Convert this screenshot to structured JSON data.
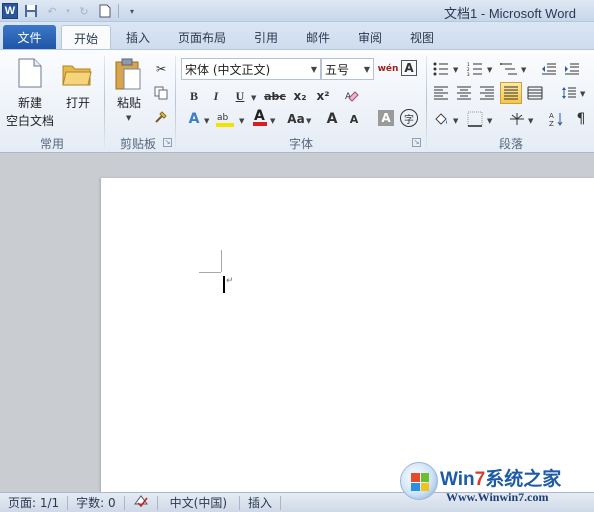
{
  "window": {
    "title": "文档1 - Microsoft Word",
    "app_icon_letter": "W"
  },
  "tabs": [
    {
      "label": "文件"
    },
    {
      "label": "开始"
    },
    {
      "label": "插入"
    },
    {
      "label": "页面布局"
    },
    {
      "label": "引用"
    },
    {
      "label": "邮件"
    },
    {
      "label": "审阅"
    },
    {
      "label": "视图"
    }
  ],
  "ribbon": {
    "groups": {
      "common": "常用",
      "clipboard": "剪贴板",
      "font": "字体",
      "paragraph": "段落"
    },
    "common": {
      "new_line1": "新建",
      "new_line2": "空白文档",
      "open": "打开"
    },
    "clipboard": {
      "paste": "粘贴"
    },
    "font": {
      "font_name": "宋体 (中文正文)",
      "font_size": "五号",
      "bold": "B",
      "italic": "I",
      "underline": "U",
      "strike": "abc",
      "subscript": "x₂",
      "superscript": "x²",
      "grow": "A",
      "shrink": "A",
      "change_case": "Aa",
      "char_shading": "A",
      "enclose": "字",
      "phonetic": "wén"
    }
  },
  "statusbar": {
    "page": "页面: 1/1",
    "words": "字数: 0",
    "language": "中文(中国)",
    "mode": "插入"
  },
  "watermark": {
    "brand_a": "Win",
    "brand_b": "7",
    "brand_c": "系统之家",
    "url": "Www.Winwin7.com"
  },
  "colors": {
    "accent": "#2b579a",
    "file_tab": "#1f55a6",
    "ribbon_bg": "#e5ecf5",
    "workspace": "#c9cdd2"
  }
}
